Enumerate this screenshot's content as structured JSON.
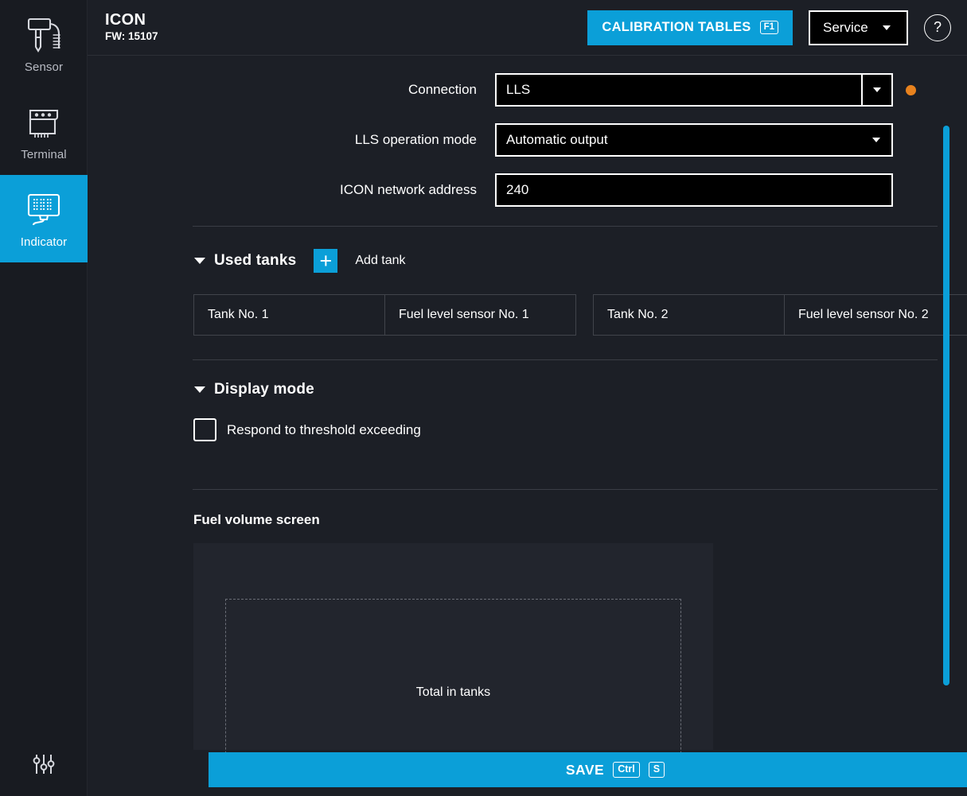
{
  "sidebar": {
    "items": [
      {
        "label": "Sensor",
        "icon": "fuel-probe-icon",
        "active": false
      },
      {
        "label": "Terminal",
        "icon": "terminal-box-icon",
        "active": false
      },
      {
        "label": "Indicator",
        "icon": "indicator-display-icon",
        "active": true
      }
    ],
    "settings_icon": "sliders-icon"
  },
  "header": {
    "title": "ICON",
    "firmware": "FW: 15107",
    "calibration_button": {
      "label": "CALIBRATION TABLES",
      "shortcut": "F1"
    },
    "service_select": {
      "value": "Service",
      "icon": "chevron-down-icon"
    },
    "help_button": {
      "label": "?"
    }
  },
  "form": {
    "rows": [
      {
        "label": "Connection",
        "value": "LLS",
        "type": "select",
        "has_status_dot": true
      },
      {
        "label": "LLS operation mode",
        "value": "Automatic output",
        "type": "select",
        "has_status_dot": false
      },
      {
        "label": "ICON network address",
        "value": "240",
        "type": "text",
        "has_status_dot": false
      }
    ],
    "status_dot_color": "#e8821e"
  },
  "used_tanks": {
    "title": "Used tanks",
    "add_tank_label": "Add tank",
    "add_tank_icon": "plus-icon",
    "cards": [
      {
        "tank": "Tank No. 1",
        "sensor": "Fuel level sensor No. 1"
      },
      {
        "tank": "Tank No. 2",
        "sensor": "Fuel level sensor No. 2"
      }
    ]
  },
  "display_mode": {
    "title": "Display mode",
    "threshold_checkbox": {
      "label": "Respond to threshold exceeding",
      "checked": false
    }
  },
  "fuel_volume_screen": {
    "title": "Fuel volume screen",
    "placeholder_label": "Total in tanks"
  },
  "save_bar": {
    "label": "SAVE",
    "shortcut_modifier": "Ctrl",
    "shortcut_key": "S"
  },
  "colors": {
    "accent": "#0b9fd8",
    "background": "#1c1f26",
    "sidebar": "#181b21",
    "panel": "#22252d",
    "status_orange": "#e8821e"
  }
}
